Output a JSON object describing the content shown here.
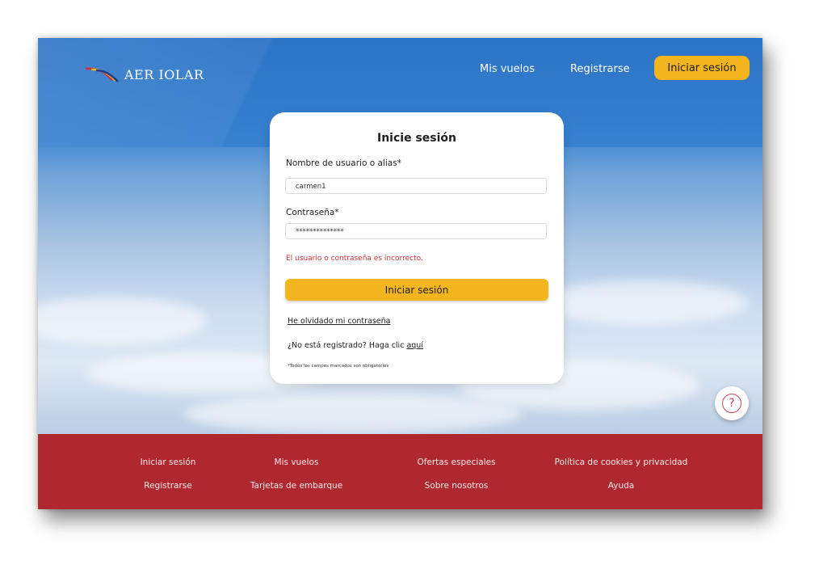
{
  "header": {
    "brand": "AER IOLAR",
    "nav": {
      "my_flights": "Mis vuelos",
      "register": "Registrarse",
      "login": "Iniciar sesión"
    }
  },
  "login_form": {
    "title": "Inicie sesión",
    "username_label": "Nombre de usuario o alias*",
    "username_value": "carmen1",
    "password_label": "Contraseña*",
    "password_value": "**************",
    "error_message": "El usuario o contraseña es incorrecto.",
    "submit_label": "Iniciar sesión",
    "forgot_password": "He olvidado mi contraseña",
    "register_prompt": "¿No está registrado? Haga clic ",
    "register_link": "aquí",
    "required_note": "*Todos los campos marcados son obligatorios"
  },
  "help": {
    "icon": "?"
  },
  "footer": {
    "columns": [
      [
        "Iniciar sesión",
        "Registrarse"
      ],
      [
        "Mis vuelos",
        "Tarjetas de embarque"
      ],
      [
        "Ofertas especiales",
        "Sobre nosotros"
      ],
      [
        "Política de cookies y privacidad",
        "Ayuda"
      ]
    ]
  },
  "colors": {
    "primary_blue": "#2c76c8",
    "accent_yellow": "#f2b51d",
    "footer_red": "#b0282f",
    "error_red": "#d23333"
  }
}
